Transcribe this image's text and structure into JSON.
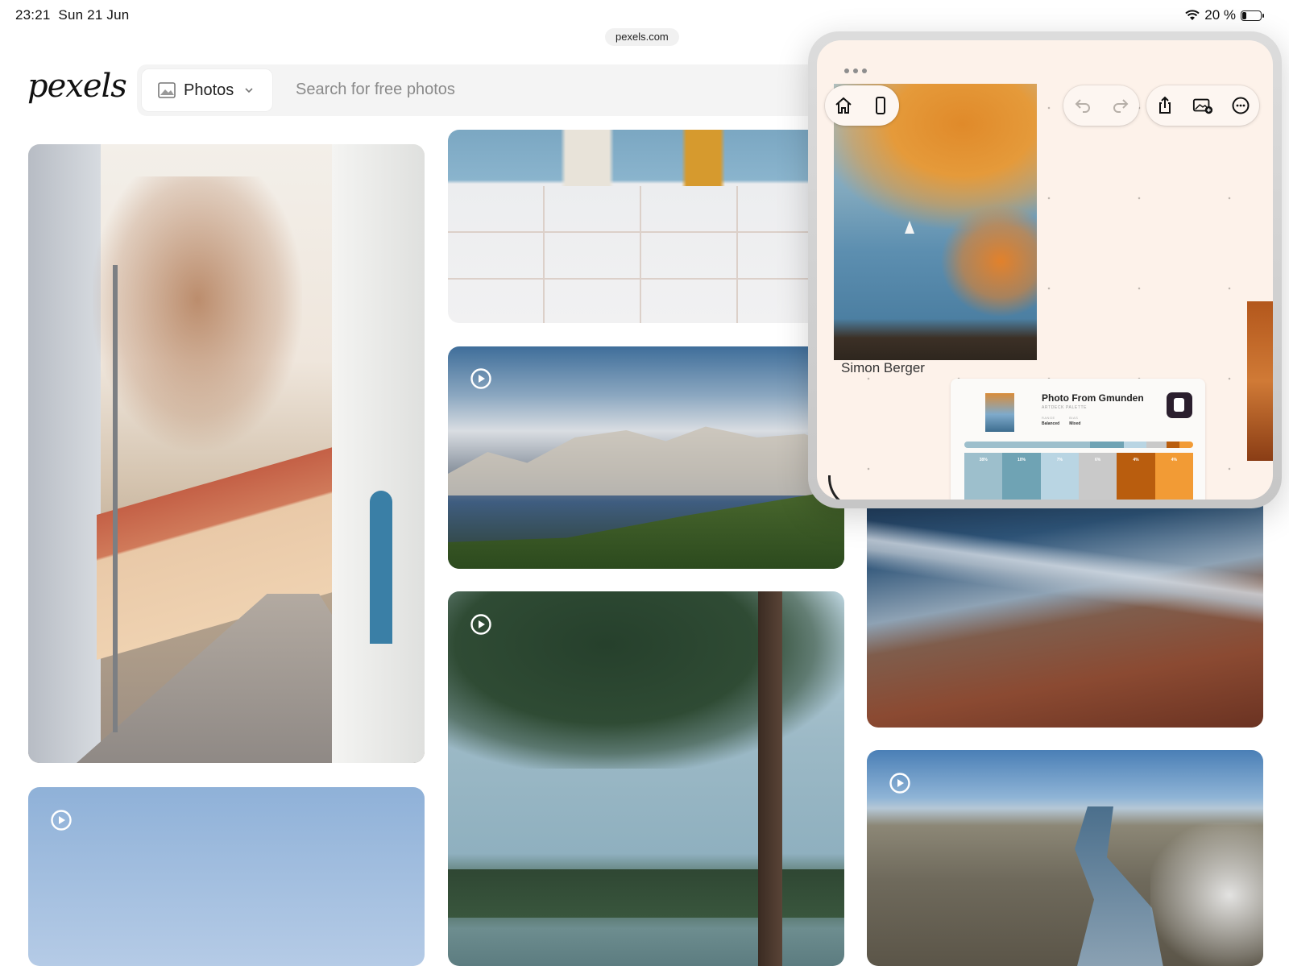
{
  "status_bar": {
    "time": "23:21",
    "date": "Sun 21 Jun",
    "battery": "20 %",
    "battery_level": 0.2
  },
  "browser": {
    "url": "pexels.com"
  },
  "header": {
    "logo": "pexels",
    "search_type": "Photos",
    "search_placeholder": "Search for free photos"
  },
  "photos": [
    {
      "name": "street",
      "is_video": false
    },
    {
      "name": "sky",
      "is_video": true
    },
    {
      "name": "beach-steps",
      "is_video": false
    },
    {
      "name": "mountains",
      "is_video": true
    },
    {
      "name": "pine",
      "is_video": true
    },
    {
      "name": "sea-beach",
      "is_video": false
    },
    {
      "name": "river",
      "is_video": true
    }
  ],
  "floating_panel": {
    "caption": "Simon Berger",
    "toolbar": {
      "left": [
        "home-icon",
        "device-icon"
      ],
      "middle": [
        "undo-icon",
        "redo-icon"
      ],
      "right": [
        "share-icon",
        "add-image-icon",
        "more-icon"
      ]
    },
    "palette_card": {
      "title": "Photo From Gmunden",
      "subtitle": "ARTDECK PALETTE",
      "meta": [
        {
          "key": "RANGE",
          "value": "Balanced"
        },
        {
          "key": "BIAS",
          "value": "Mixed"
        }
      ],
      "swatches": [
        {
          "label": "38%",
          "color": "#9dbfcc"
        },
        {
          "label": "10%",
          "color": "#6fa3b4"
        },
        {
          "label": "7%",
          "color": "#b9d5e3"
        },
        {
          "label": "6%",
          "color": "#c9c9c9"
        },
        {
          "label": "4%",
          "color": "#b95d0e"
        },
        {
          "label": "4%",
          "color": "#f29b35"
        }
      ]
    }
  },
  "colors": {
    "panel_bg": "#fdf2ea",
    "accent": "#f29b35"
  }
}
